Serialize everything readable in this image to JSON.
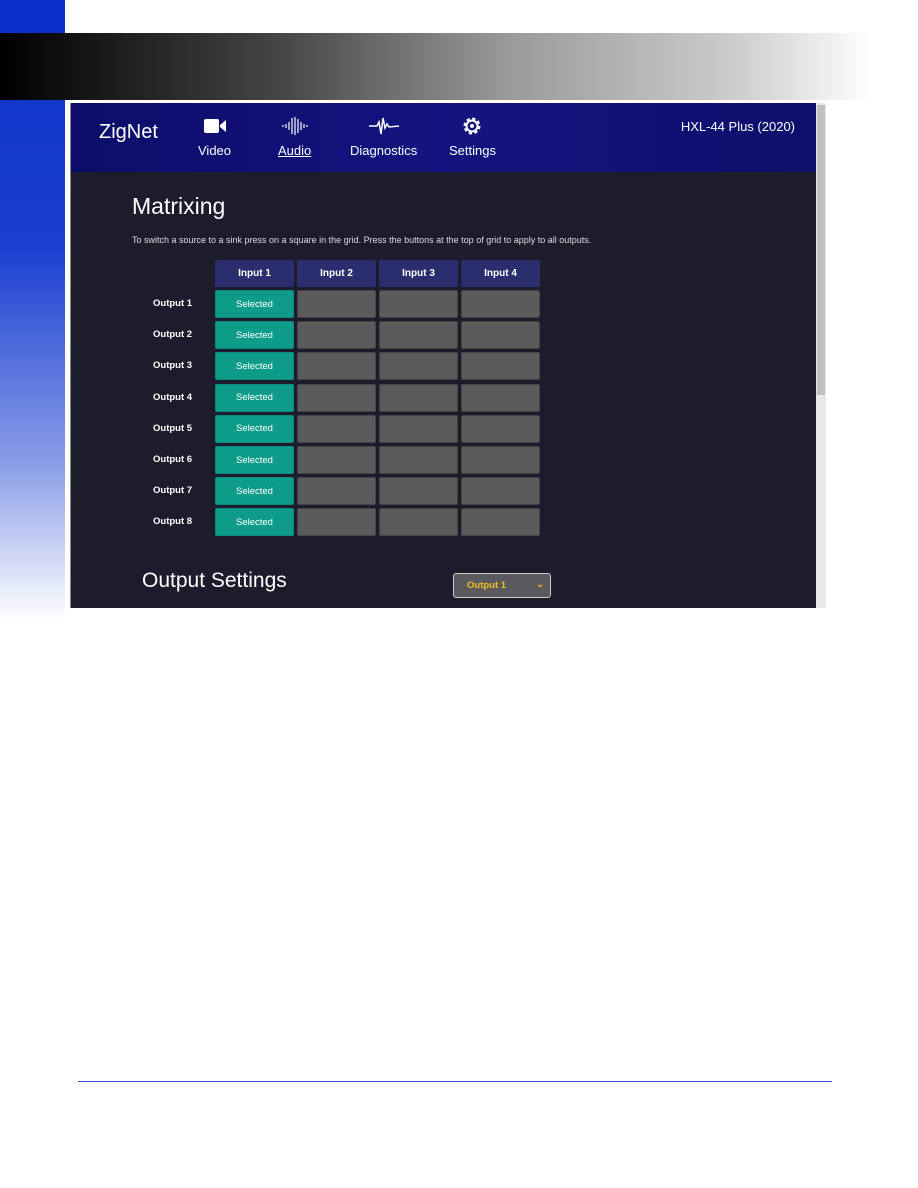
{
  "header": {
    "logo": "ZigNet",
    "device": "HXL-44 Plus (2020)",
    "nav": [
      {
        "label": "Video",
        "icon": "video-camera-icon"
      },
      {
        "label": "Audio",
        "icon": "audio-wave-icon",
        "active": true
      },
      {
        "label": "Diagnostics",
        "icon": "heartbeat-icon"
      },
      {
        "label": "Settings",
        "icon": "gear-icon"
      }
    ]
  },
  "matrix": {
    "title": "Matrixing",
    "description": "To switch a source to a sink press on a square in the grid. Press the buttons at the top of grid to apply to all outputs.",
    "inputs": [
      "Input 1",
      "Input 2",
      "Input 3",
      "Input 4"
    ],
    "outputs": [
      "Output 1",
      "Output 2",
      "Output 3",
      "Output 4",
      "Output 5",
      "Output 6",
      "Output 7",
      "Output 8"
    ],
    "selected_input": [
      0,
      0,
      0,
      0,
      0,
      0,
      0,
      0
    ],
    "selected_label": "Selected"
  },
  "output_settings": {
    "title": "Output Settings",
    "selected": "Output 1"
  },
  "colors": {
    "selected": "#0d9c8a",
    "header": "#0c0c6a",
    "accent": "#f0c020"
  }
}
